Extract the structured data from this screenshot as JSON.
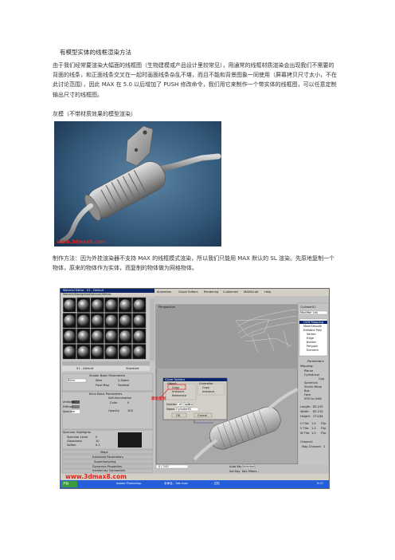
{
  "document": {
    "title": "有模型实体的线框渲染方法",
    "paragraph1": "由于我们经常要渲染大幅面的线框图（生物建模或产品设计里较常见），用通常的线框材质渲染会出现我们不需要的背面的线条，和正面线条交叉在一起时画面线条杂乱不堪，而且不能和背景图象一同使用（屏幕拷贝尺寸太小，不在此讨论范围），因此 MAX 在 5.0 以后增加了 PUSH 修改命令，我们用它来制作一个带实体的线框图，可以任意定制输出尺寸的线框图。",
    "caption1": "灰模（不带材质效果的模型渲染）",
    "paragraph2": "制作方法：因为外挂渲染器不支持 MAX 的线框模式渲染，所以我们只能用 MAX 默认的 SL 渲染。先原地复制一个物体，原来的物体作为实体，而复制的物体做为网格物体。"
  },
  "figure1": {
    "watermark": "www.3dmax8.com"
  },
  "figure2": {
    "watermark": "www.3dmax8.com",
    "material_editor": {
      "title": "Material Editor - 01 - Default",
      "menu": [
        "Material",
        "Navigation",
        "Options",
        "Utilities"
      ],
      "material_name": "01 - Default",
      "material_type": "Standard",
      "shader_rollout": "Shader Basic Parameters",
      "shader": "Blinn",
      "shader_options": [
        "Wire",
        "2-Sided",
        "Face Map",
        "Faceted"
      ],
      "blinn_rollout": "Blinn Basic Parameters",
      "self_illum": "Self-Illumination",
      "color_label": "Color",
      "color_value": "0",
      "opacity_label": "Opacity",
      "opacity_value": "100",
      "channels": [
        "Ambient",
        "Diffuse",
        "Specular"
      ],
      "specular_highlights": "Specular Highlights",
      "spec_rows": [
        {
          "label": "Specular Level",
          "value": "0"
        },
        {
          "label": "Glossiness",
          "value": "10"
        },
        {
          "label": "Soften",
          "value": "0.1"
        }
      ],
      "rollouts": [
        "Maps",
        "Extended Parameters",
        "SuperSampling",
        "Dynamics Properties",
        "mental ray Connection"
      ]
    },
    "menubar": [
      "Animation",
      "Graph Editors",
      "Rendering",
      "Customize",
      "MAXScript",
      "Help"
    ],
    "viewport_label": "Perspective",
    "clone_dialog": {
      "title": "Clone Options",
      "group_object": "Object",
      "options": [
        "Copy",
        "Instance",
        "Reference"
      ],
      "selected": "Copy",
      "controller_group": "Controller",
      "controller_options": [
        "Copy",
        "Instance"
      ],
      "copies_label": "Number of Copies:",
      "copies_value": "1",
      "name_label": "Name:",
      "name_value": "Cylinder02",
      "ok": "OK",
      "cancel": "Cancel"
    },
    "annotation": "原地复制",
    "command_panel": {
      "object_name": "Cylinder01",
      "modifier_list": "Modifier List",
      "stack": [
        "UVW Mapping",
        "MeshSmooth",
        "Editable Poly",
        "Vertex",
        "Edge",
        "Border",
        "Polygon",
        "Element"
      ],
      "params_title": "Parameters",
      "mapping_title": "Mapping:",
      "mapping": [
        "Planar",
        "Cylindrical",
        "Cap",
        "Spherical",
        "Shrink Wrap",
        "Box",
        "Face",
        "XYZ to UVW"
      ],
      "dims": [
        {
          "label": "Length:",
          "value": "80.215"
        },
        {
          "label": "Width:",
          "value": "80.215"
        },
        {
          "label": "Height:",
          "value": "274.84"
        }
      ],
      "tiles": [
        {
          "label": "U Tile:",
          "value": "1.0",
          "flip": "Flip"
        },
        {
          "label": "V Tile:",
          "value": "1.0",
          "flip": "Flip"
        },
        {
          "label": "W Tile:",
          "value": "1.0",
          "flip": "Flip"
        }
      ],
      "channel_title": "Channel:",
      "map_channel": "Map Channel:",
      "map_channel_value": "1"
    },
    "status": {
      "frame": "0 / 100",
      "auto_key": "Auto Key",
      "selected": "Selected",
      "set_key": "Set Key",
      "key_filters": "Key Filters..."
    },
    "taskbar": [
      "开始",
      "Adobe Photoshop",
      "未命名 - 3ds max",
      "- 文档"
    ],
    "clock": "9:07"
  }
}
